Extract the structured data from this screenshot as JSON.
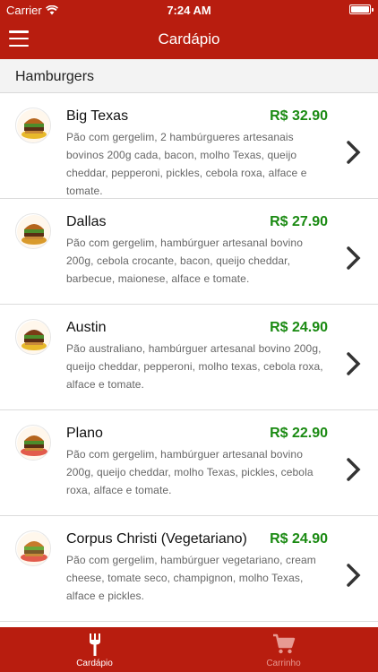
{
  "status_bar": {
    "carrier": "Carrier",
    "time": "7:24 AM"
  },
  "nav": {
    "title": "Cardápio"
  },
  "section": {
    "title": "Hamburgers"
  },
  "items": [
    {
      "name": "Big Texas",
      "price": "R$ 32.90",
      "description": "Pão com gergelim, 2 hambúrgueres artesanais bovinos 200g cada, bacon, molho Texas, queijo cheddar, pepperoni, pickles, cebola roxa, alface e tomate."
    },
    {
      "name": "Dallas",
      "price": "R$ 27.90",
      "description": "Pão com gergelim, hambúrguer artesanal bovino 200g, cebola crocante, bacon, queijo cheddar, barbecue, maionese, alface e tomate."
    },
    {
      "name": "Austin",
      "price": "R$ 24.90",
      "description": "Pão australiano, hambúrguer artesanal bovino 200g, queijo cheddar, pepperoni, molho texas, cebola roxa, alface e tomate."
    },
    {
      "name": "Plano",
      "price": "R$ 22.90",
      "description": "Pão com gergelim, hambúrguer artesanal bovino 200g, queijo cheddar, molho Texas, pickles, cebola roxa, alface e tomate."
    },
    {
      "name": "Corpus Christi (Vegetariano)",
      "price": "R$ 24.90",
      "description": "Pão com gergelim, hambúrguer vegetariano, cream cheese, tomate seco, champignon, molho Texas, alface e pickles."
    }
  ],
  "tabs": [
    {
      "label": "Cardápio",
      "icon": "fork-icon",
      "active": true
    },
    {
      "label": "Carrinho",
      "icon": "cart-icon",
      "active": false
    }
  ],
  "colors": {
    "brand": "#b81d0f",
    "price": "#1a8a12",
    "tab_inactive": "#e79a92"
  }
}
